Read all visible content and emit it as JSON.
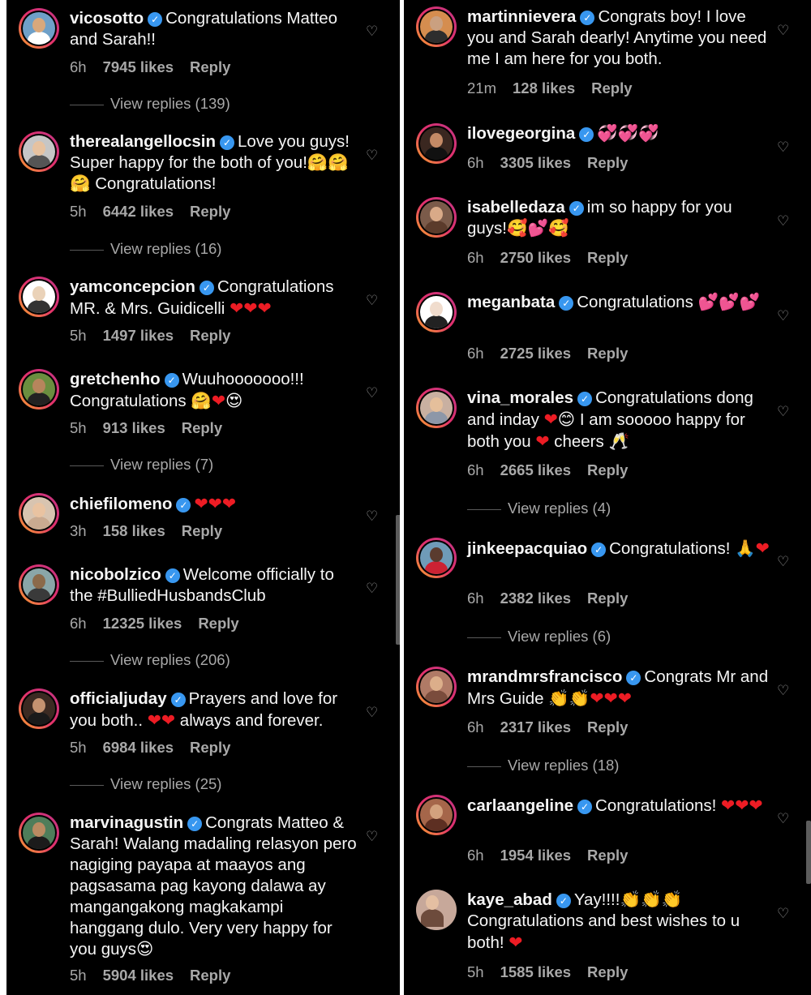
{
  "left_comments": [
    {
      "username": "vicosotto",
      "text": "Congratulations Matteo and Sarah!!",
      "time": "6h",
      "likes": "7945 likes",
      "reply": "Reply",
      "view_replies": "View replies (139)"
    },
    {
      "username": "therealangellocsin",
      "text": "Love you guys! Super happy for the both of you!🤗🤗🤗 Congratulations!",
      "time": "5h",
      "likes": "6442 likes",
      "reply": "Reply",
      "view_replies": "View replies (16)"
    },
    {
      "username": "yamconcepcion",
      "text": "Congratulations MR. & Mrs. Guidicelli ❤❤❤",
      "time": "5h",
      "likes": "1497 likes",
      "reply": "Reply"
    },
    {
      "username": "gretchenho",
      "text": "Wuuhooooooo!!! Congratulations 🤗❤😍",
      "time": "5h",
      "likes": "913 likes",
      "reply": "Reply",
      "view_replies": "View replies (7)"
    },
    {
      "username": "chiefilomeno",
      "text": "❤❤❤",
      "time": "3h",
      "likes": "158 likes",
      "reply": "Reply"
    },
    {
      "username": "nicobolzico",
      "text": "Welcome officially to the #BulliedHusbandsClub",
      "time": "6h",
      "likes": "12325 likes",
      "reply": "Reply",
      "view_replies": "View replies (206)"
    },
    {
      "username": "officialjuday",
      "text": "Prayers and love for you both.. ❤❤ always and forever.",
      "time": "5h",
      "likes": "6984 likes",
      "reply": "Reply",
      "view_replies": "View replies (25)"
    },
    {
      "username": "marvinagustin",
      "text": "Congrats Matteo & Sarah! Walang madaling relasyon pero nagiging payapa at maayos ang pagsasama pag kayong dalawa ay mangangakong magkakampi hanggang dulo. Very very happy for you guys😍",
      "time": "5h",
      "likes": "5904 likes",
      "reply": "Reply"
    }
  ],
  "right_comments": [
    {
      "username": "martinnievera",
      "text": "Congrats boy! I love you and Sarah dearly! Anytime you need me I am here for you both.",
      "time": "21m",
      "likes": "128 likes",
      "reply": "Reply"
    },
    {
      "username": "ilovegeorgina",
      "text": "💞💞💞",
      "time": "6h",
      "likes": "3305 likes",
      "reply": "Reply"
    },
    {
      "username": "isabelledaza",
      "text": "im so happy for you guys!🥰💕🥰",
      "time": "6h",
      "likes": "2750 likes",
      "reply": "Reply"
    },
    {
      "username": "meganbata",
      "text": "Congratulations 💕💕💕",
      "time": "6h",
      "likes": "2725 likes",
      "reply": "Reply"
    },
    {
      "username": "vina_morales",
      "text": "Congratulations dong and inday ❤😊 I am sooooo happy for both you ❤ cheers 🥂",
      "time": "6h",
      "likes": "2665 likes",
      "reply": "Reply",
      "view_replies": "View replies (4)"
    },
    {
      "username": "jinkeepacquiao",
      "text": "Congratulations! 🙏❤",
      "time": "6h",
      "likes": "2382 likes",
      "reply": "Reply",
      "view_replies": "View replies (6)"
    },
    {
      "username": "mrandmrsfrancisco",
      "text": "Congrats Mr and Mrs Guide 👏👏❤❤❤",
      "time": "6h",
      "likes": "2317 likes",
      "reply": "Reply",
      "view_replies": "View replies (18)"
    },
    {
      "username": "carlaangeline",
      "text": "Congratulations! ❤❤❤",
      "time": "6h",
      "likes": "1954 likes",
      "reply": "Reply"
    },
    {
      "username": "kaye_abad",
      "text": "Yay!!!!👏👏👏 Congratulations and best wishes to u both! ❤",
      "time": "5h",
      "likes": "1585 likes",
      "reply": "Reply"
    }
  ],
  "icons": {
    "like": "heart-outline-icon",
    "verified": "verified-badge-icon"
  },
  "colors": {
    "background": "#000000",
    "text": "#f5f5f5",
    "muted": "#a8a8a8",
    "verified": "#3897f0",
    "heart": "#ed1c24",
    "story_ring": "#e1306c"
  }
}
